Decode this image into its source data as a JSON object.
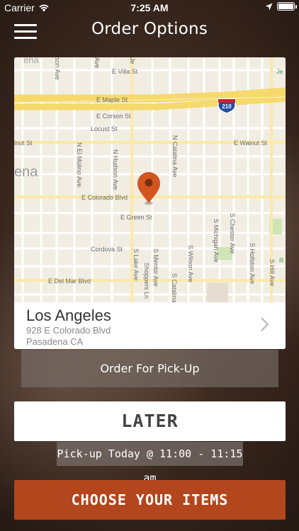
{
  "status_bar": {
    "carrier": "Carrier",
    "time": "7:25 AM",
    "icons": [
      "wifi-icon",
      "location-arrow-icon",
      "battery-icon"
    ]
  },
  "nav": {
    "title": "Order Options",
    "menu_icon": "hamburger-menu-icon"
  },
  "map": {
    "street_labels": [
      "E Villa St",
      "E Maple St",
      "E Corson St",
      "Locust St",
      "E Walnut St",
      "lnut St",
      "E Colorado Blvd",
      "E Green St",
      "Cordova St",
      "E Del Mar Blvd",
      "N El Molino Ave",
      "N Hudson Ave",
      "N Lake Ave",
      "N Catalina Ave",
      "S Lake Ave",
      "S Mentor Ave",
      "Shoppers Ln",
      "S Catalina",
      "S Wilson Ave",
      "S Michigan Ave",
      "S Chester Ave",
      "S Hollston Ave",
      "S Hill Ave",
      "son Ave",
      "Ave",
      "ena",
      "Je",
      "R"
    ],
    "highway_shield": "210",
    "marker_icon": "map-pin-icon",
    "colors": {
      "highway": "#f6d96b",
      "major_road": "#fbe9a8",
      "pin": "#d2541f",
      "park": "#cfe5b8"
    }
  },
  "location": {
    "city": "Los Angeles",
    "address_line1": "928 E Colorado Blvd",
    "address_line2": "Pasadena CA"
  },
  "order_type": {
    "label": "Order For Pick-Up"
  },
  "schedule": {
    "later_label": "LATER",
    "pickup_time": "Pick-up Today @ 11:00 - 11:15 am"
  },
  "actions": {
    "choose_items_label": "CHOOSE YOUR ITEMS"
  },
  "colors": {
    "accent": "#b3461d",
    "card_bg": "#ffffff",
    "button_overlay": "#786e69"
  }
}
